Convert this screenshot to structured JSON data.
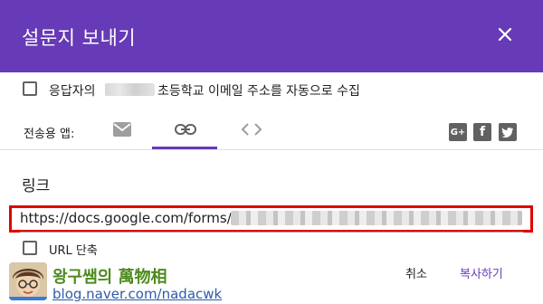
{
  "dialog": {
    "title": "설문지 보내기",
    "close_icon": "close-icon"
  },
  "collect_email": {
    "checked": false,
    "text_before": "응답자의",
    "text_after": "초등학교 이메일 주소를 자동으로 수집"
  },
  "send_via": {
    "label": "전송용 앱:",
    "tabs": [
      {
        "icon": "mail-icon",
        "active": false
      },
      {
        "icon": "link-icon",
        "active": true
      },
      {
        "icon": "embed-code-icon",
        "active": false
      }
    ],
    "social": [
      {
        "icon": "google-plus-icon",
        "glyph": "G+"
      },
      {
        "icon": "facebook-icon",
        "glyph": "f"
      },
      {
        "icon": "twitter-icon",
        "glyph": "🐦"
      }
    ]
  },
  "link_section": {
    "title": "링크",
    "url_visible": "https://docs.google.com/forms/",
    "shorten_label": "URL 단축",
    "shorten_checked": false
  },
  "actions": {
    "cancel_label": "취소",
    "copy_label": "복사하기"
  },
  "watermark": {
    "name": "왕구쌤의 萬物相",
    "url": "blog.naver.com/nadacwk"
  },
  "colors": {
    "header": "#673ab7",
    "accent": "#673ab7",
    "highlight_box": "#e00000"
  }
}
